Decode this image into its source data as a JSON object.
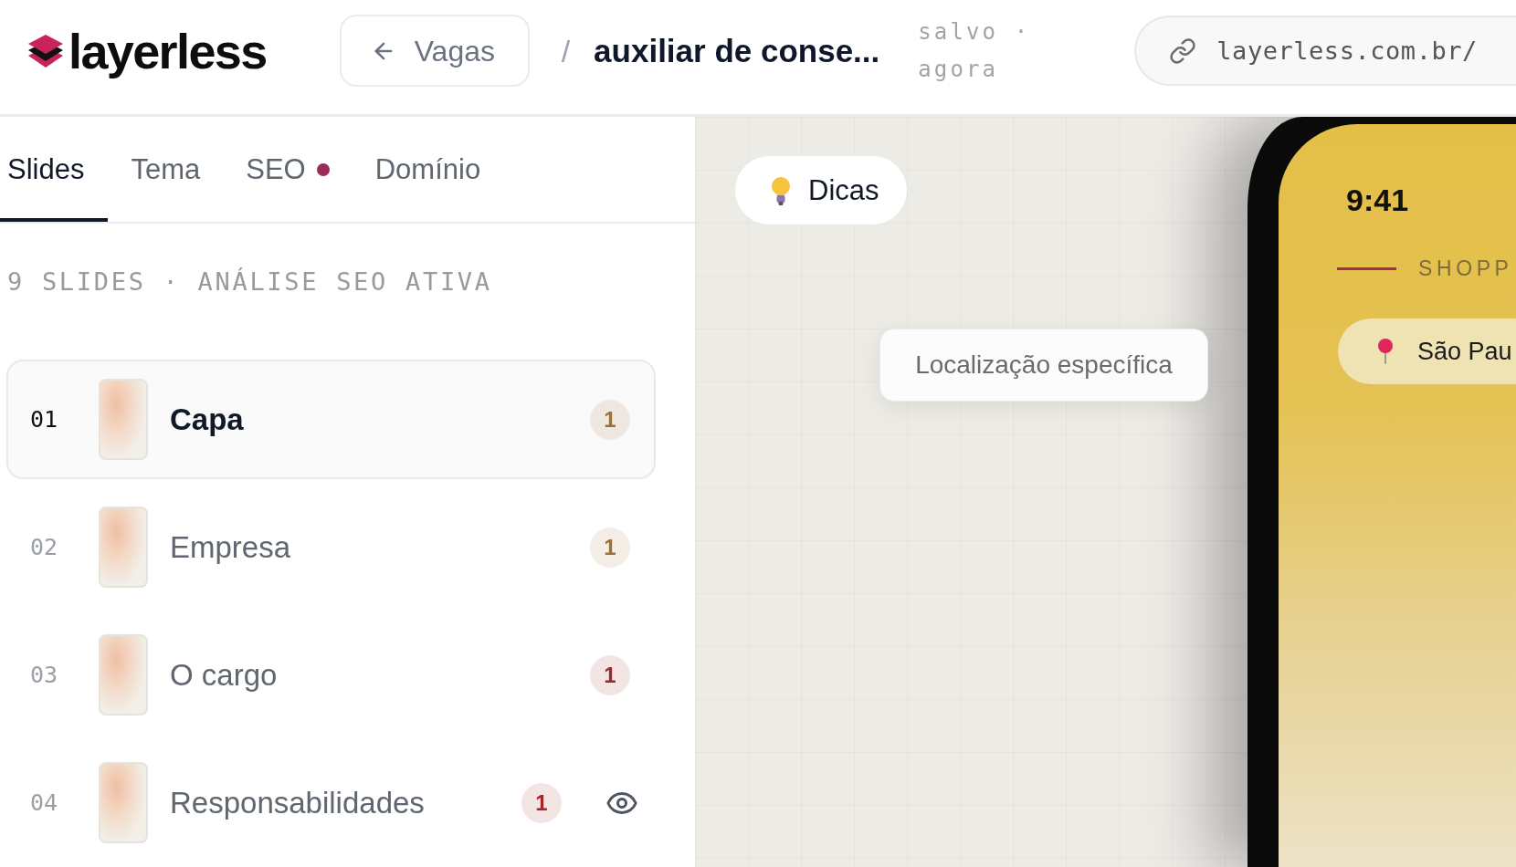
{
  "header": {
    "logo": "layerless",
    "back_button": "Vagas",
    "separator": "/",
    "document_title": "auxiliar de conse...",
    "save_status": "salvo · agora",
    "url": "layerless.com.br/"
  },
  "tabs": [
    {
      "label": "Slides",
      "selected": true,
      "dot": false
    },
    {
      "label": "Tema",
      "selected": false,
      "dot": false
    },
    {
      "label": "SEO",
      "selected": false,
      "dot": true
    },
    {
      "label": "Domínio",
      "selected": false,
      "dot": false
    }
  ],
  "summary": "9 SLIDES · ANÁLISE SEO ATIVA",
  "slides": [
    {
      "number": "01",
      "title": "Capa",
      "selected": true,
      "issues": "1",
      "color": "#a26f2c",
      "show_preview": false
    },
    {
      "number": "02",
      "title": "Empresa",
      "selected": false,
      "issues": "1",
      "color": "#a26f2c",
      "show_preview": false
    },
    {
      "number": "03",
      "title": "O cargo",
      "selected": false,
      "issues": "1",
      "color": "#a3262a",
      "show_preview": false
    },
    {
      "number": "04",
      "title": "Responsabilidades",
      "selected": false,
      "issues": "1",
      "color": "#a3262a",
      "show_preview": true
    }
  ],
  "canvas": {
    "tips_button": "Dicas",
    "tooltip": "Localização específica",
    "phone": {
      "time": "9:41",
      "section_label": "SHOPP",
      "location": "São Pau"
    }
  }
}
